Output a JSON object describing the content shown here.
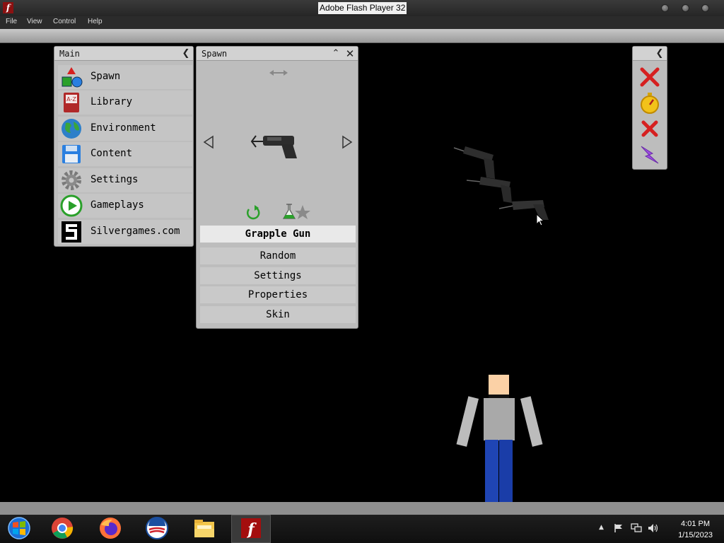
{
  "window": {
    "title": "Adobe Flash Player 32",
    "menu": [
      "File",
      "View",
      "Control",
      "Help"
    ]
  },
  "main_panel": {
    "title": "Main",
    "items": [
      {
        "label": "Spawn",
        "icon": "shapes-icon"
      },
      {
        "label": "Library",
        "icon": "book-icon"
      },
      {
        "label": "Environment",
        "icon": "globe-icon"
      },
      {
        "label": "Content",
        "icon": "floppy-disk-icon"
      },
      {
        "label": "Settings",
        "icon": "gear-icon"
      },
      {
        "label": "Gameplays",
        "icon": "play-icon"
      },
      {
        "label": "Silvergames.com",
        "icon": "silvergames-logo-icon"
      }
    ]
  },
  "spawn_panel": {
    "title": "Spawn",
    "selected_item": "Grapple Gun",
    "options": [
      "Random",
      "Settings",
      "Properties",
      "Skin"
    ]
  },
  "tools_panel": {
    "buttons": [
      "delete-red-x-icon",
      "stopwatch-icon",
      "close-red-x-icon",
      "lightning-icon"
    ]
  },
  "taskbar": {
    "apps": [
      "windows-start-icon",
      "chrome-icon",
      "firefox-icon",
      "obama-logo-icon",
      "file-explorer-icon",
      "flash-player-icon"
    ],
    "time": "4:01 PM",
    "date": "1/15/2023"
  },
  "colors": {
    "panel_bg": "#bdbdbd",
    "background": "#000000",
    "red": "#d62020",
    "green": "#2aa02a"
  }
}
